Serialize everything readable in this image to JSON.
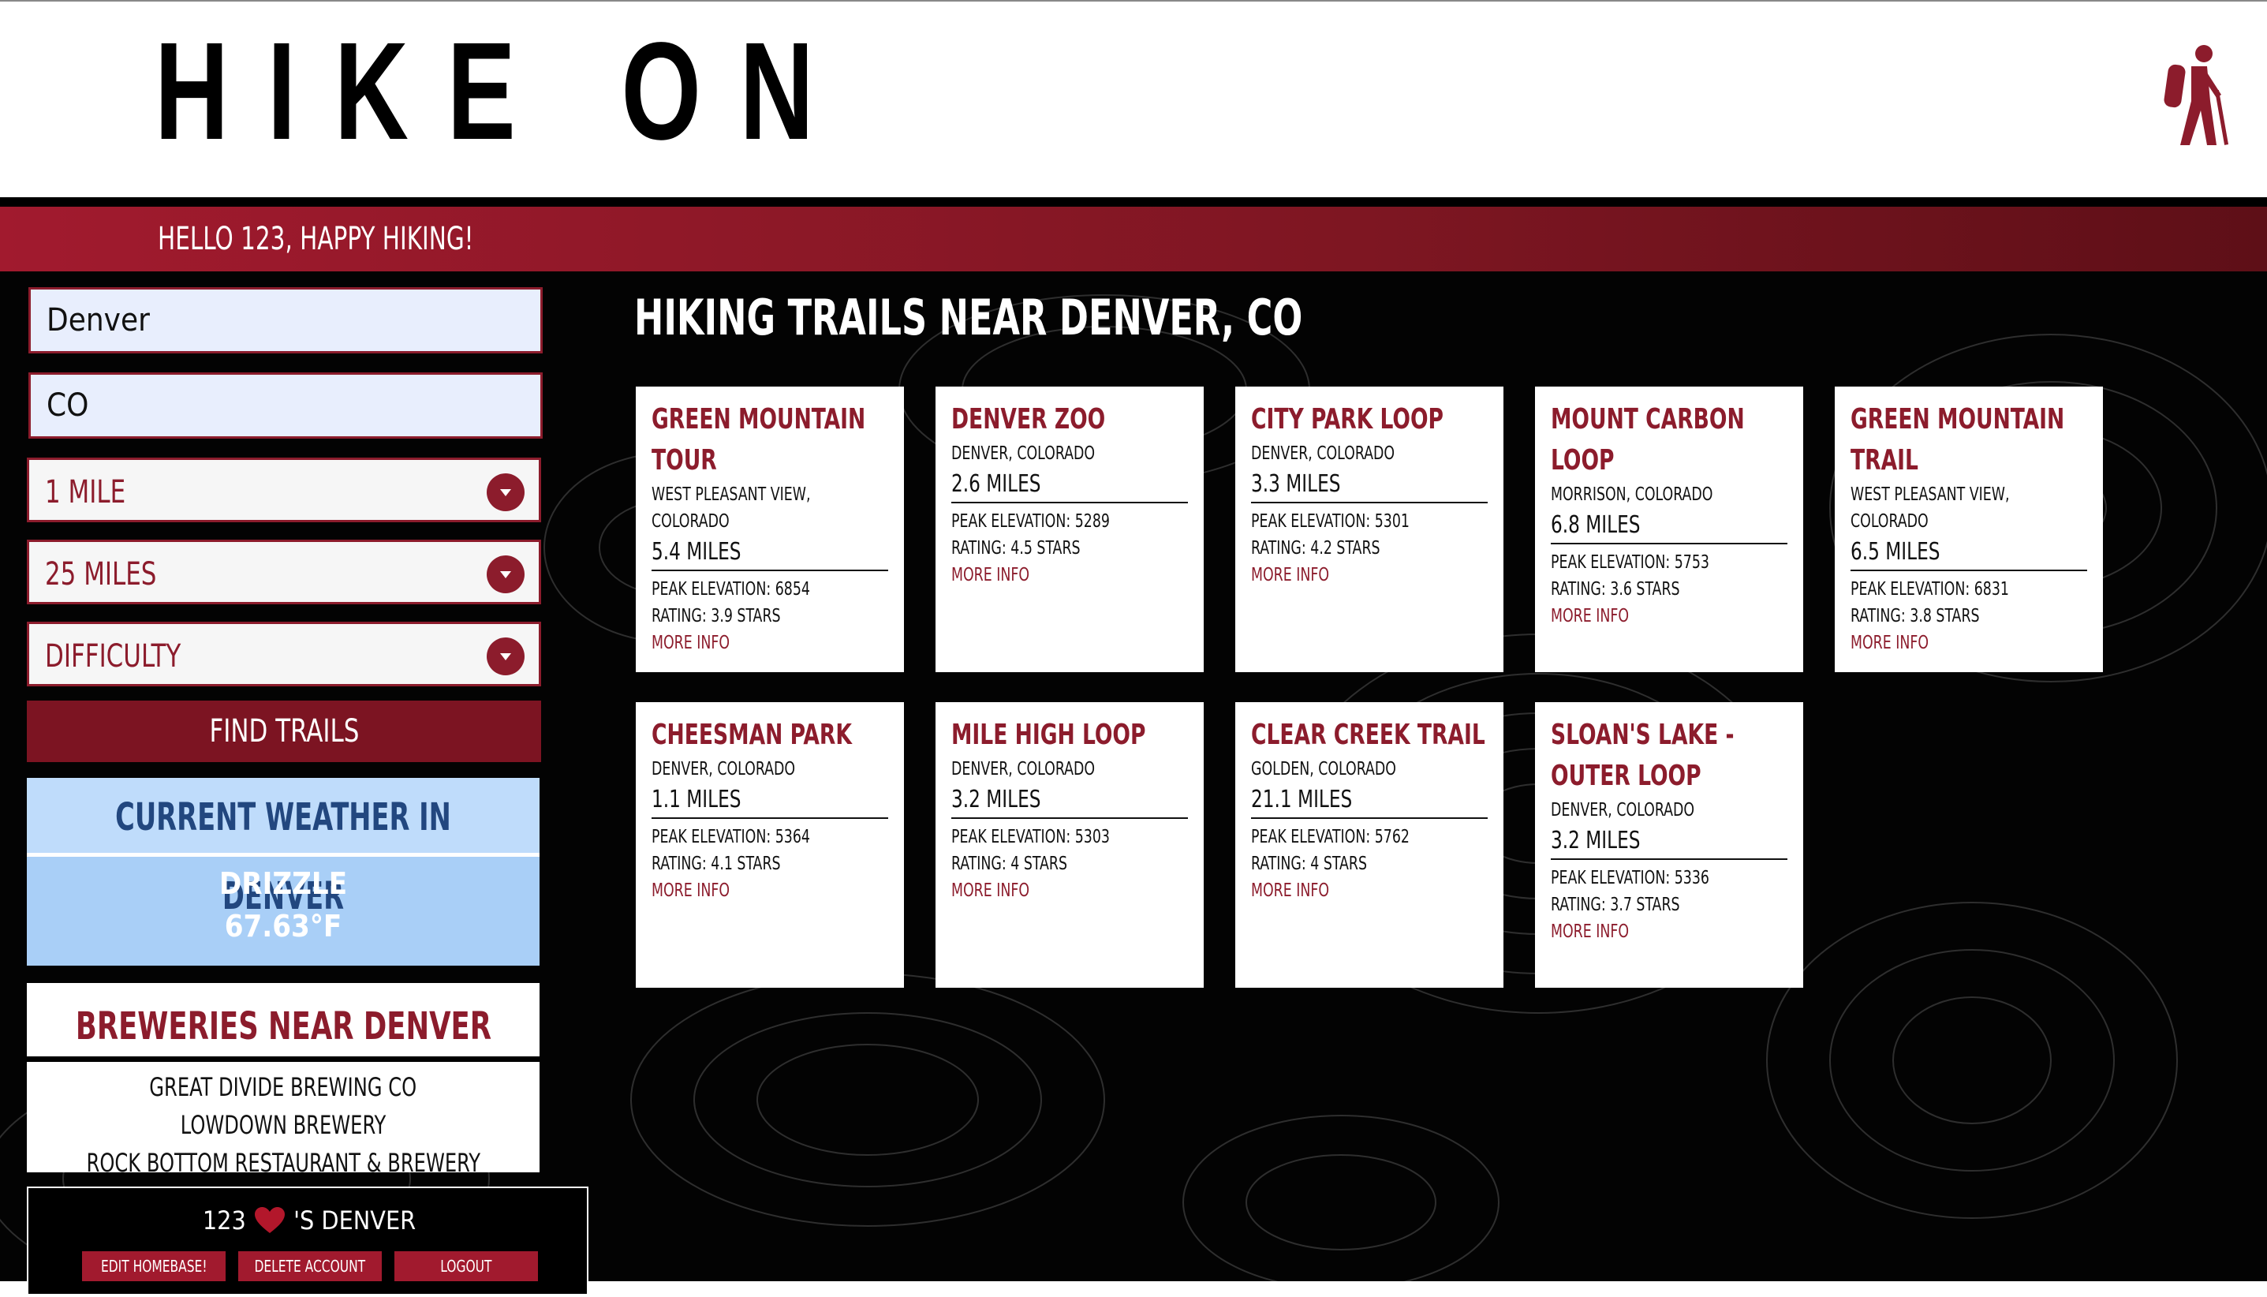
{
  "header": {
    "logo": "HIKE ON",
    "greeting": "HELLO 123, HAPPY HIKING!"
  },
  "search": {
    "city": "Denver",
    "state": "CO",
    "min_distance": "1 MILE",
    "max_distance": "25 MILES",
    "difficulty": "DIFFICULTY",
    "find_label": "FIND TRAILS"
  },
  "weather": {
    "title": "CURRENT WEATHER IN DENVER",
    "condition": "DRIZZLE",
    "temperature": "67.63°F"
  },
  "breweries": {
    "title": "BREWERIES NEAR DENVER",
    "items": [
      "GREAT DIVIDE BREWING CO",
      "LOWDOWN BREWERY",
      "ROCK BOTTOM RESTAURANT & BREWERY"
    ]
  },
  "homebase": {
    "user": "123",
    "city_text": "'S DENVER",
    "edit_label": "EDIT HOMEBASE!",
    "delete_label": "DELETE ACCOUNT",
    "logout_label": "LOGOUT"
  },
  "colors": {
    "accent": "#8c1c2c",
    "weather_title": "#22477f",
    "weather_bg": "#a9cff7"
  },
  "icons": {
    "brand": "hiker-icon",
    "homebase": "heart-icon",
    "select": "chevron-down-icon"
  },
  "trails": {
    "title": "HIKING TRAILS NEAR DENVER, CO",
    "more_label": "MORE INFO",
    "cards": [
      {
        "name": "GREEN MOUNTAIN TOUR",
        "location": "WEST PLEASANT VIEW, COLORADO",
        "length": "5.4 MILES",
        "elevation": "PEAK ELEVATION: 6854",
        "rating": "RATING: 3.9 STARS"
      },
      {
        "name": "DENVER ZOO",
        "location": "DENVER, COLORADO",
        "length": "2.6 MILES",
        "elevation": "PEAK ELEVATION: 5289",
        "rating": "RATING: 4.5 STARS"
      },
      {
        "name": "CITY PARK LOOP",
        "location": "DENVER, COLORADO",
        "length": "3.3 MILES",
        "elevation": "PEAK ELEVATION: 5301",
        "rating": "RATING: 4.2 STARS"
      },
      {
        "name": "MOUNT CARBON LOOP",
        "location": "MORRISON, COLORADO",
        "length": "6.8 MILES",
        "elevation": "PEAK ELEVATION: 5753",
        "rating": "RATING: 3.6 STARS"
      },
      {
        "name": "GREEN MOUNTAIN TRAIL",
        "location": "WEST PLEASANT VIEW, COLORADO",
        "length": "6.5 MILES",
        "elevation": "PEAK ELEVATION: 6831",
        "rating": "RATING: 3.8 STARS"
      },
      {
        "name": "CHEESMAN PARK",
        "location": "DENVER, COLORADO",
        "length": "1.1 MILES",
        "elevation": "PEAK ELEVATION: 5364",
        "rating": "RATING: 4.1 STARS"
      },
      {
        "name": "MILE HIGH LOOP",
        "location": "DENVER, COLORADO",
        "length": "3.2 MILES",
        "elevation": "PEAK ELEVATION: 5303",
        "rating": "RATING: 4 STARS"
      },
      {
        "name": "CLEAR CREEK TRAIL",
        "location": "GOLDEN, COLORADO",
        "length": "21.1 MILES",
        "elevation": "PEAK ELEVATION: 5762",
        "rating": "RATING: 4 STARS"
      },
      {
        "name": "SLOAN'S LAKE - OUTER LOOP",
        "location": "DENVER, COLORADO",
        "length": "3.2 MILES",
        "elevation": "PEAK ELEVATION: 5336",
        "rating": "RATING: 3.7 STARS"
      }
    ]
  }
}
